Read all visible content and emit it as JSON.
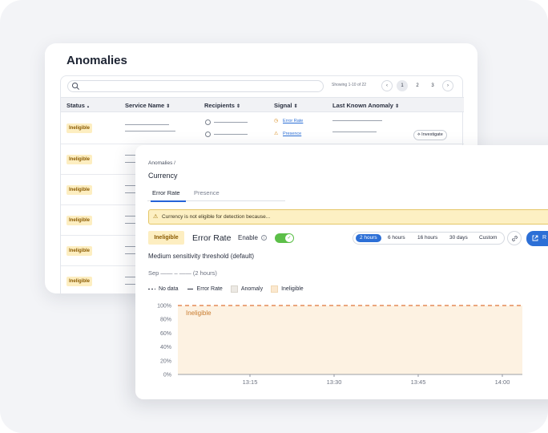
{
  "anomalies": {
    "title": "Anomalies",
    "showing": "Showing 1-10 of 22",
    "pages": [
      "1",
      "2",
      "3"
    ],
    "columns": [
      "Status",
      "Service Name",
      "Recipients",
      "Signal",
      "Last Known Anomaly"
    ],
    "column_sort_icons": [
      "▲",
      "⇕",
      "⇕",
      "⇕",
      "⇕"
    ],
    "rows": [
      {
        "status": "Ineligible",
        "signals": [
          "Error Rate",
          "Presence"
        ],
        "action": "Investigate"
      },
      {
        "status": "Ineligible"
      },
      {
        "status": "Ineligible"
      },
      {
        "status": "Ineligible"
      },
      {
        "status": "Ineligible"
      },
      {
        "status": "Ineligible"
      }
    ]
  },
  "detail": {
    "breadcrumb": "Anomalies /",
    "title": "Currency",
    "tabs": [
      "Error Rate",
      "Presence"
    ],
    "active_tab": "Error Rate",
    "warning": "Currency is not eligible for detection because...",
    "status_badge": "Ineligible",
    "signal_title": "Error Rate",
    "enable_label": "Enable",
    "enabled": true,
    "time_ranges": [
      "2 hours",
      "6 hours",
      "16 hours",
      "30 days",
      "Custom"
    ],
    "active_range": "2 hours",
    "action_button": "R",
    "threshold_text": "Medium sensitivity threshold (default)",
    "date_range": "Sep —— – —— (2 hours)",
    "legend": [
      {
        "marker": "dashed",
        "label": "No data"
      },
      {
        "marker": "line",
        "label": "Error Rate"
      },
      {
        "marker": "swatch-grey",
        "label": "Anomaly"
      },
      {
        "marker": "swatch-peach",
        "label": "Ineligible"
      }
    ],
    "colors": {
      "accent": "#2c6fd6",
      "ineligible_fill": "#fdf2e2",
      "threshold": "#e0763a",
      "badge_bg": "#fdeec1",
      "toggle_on": "#5cbf48"
    }
  },
  "chart_data": {
    "type": "area",
    "x": [
      "13:15",
      "13:30",
      "13:45",
      "14:00"
    ],
    "y_ticks": [
      "100%",
      "80%",
      "60%",
      "40%",
      "20%",
      "0%"
    ],
    "ylim": [
      0,
      100
    ],
    "threshold": 100,
    "region_label": "Ineligible",
    "series": []
  }
}
